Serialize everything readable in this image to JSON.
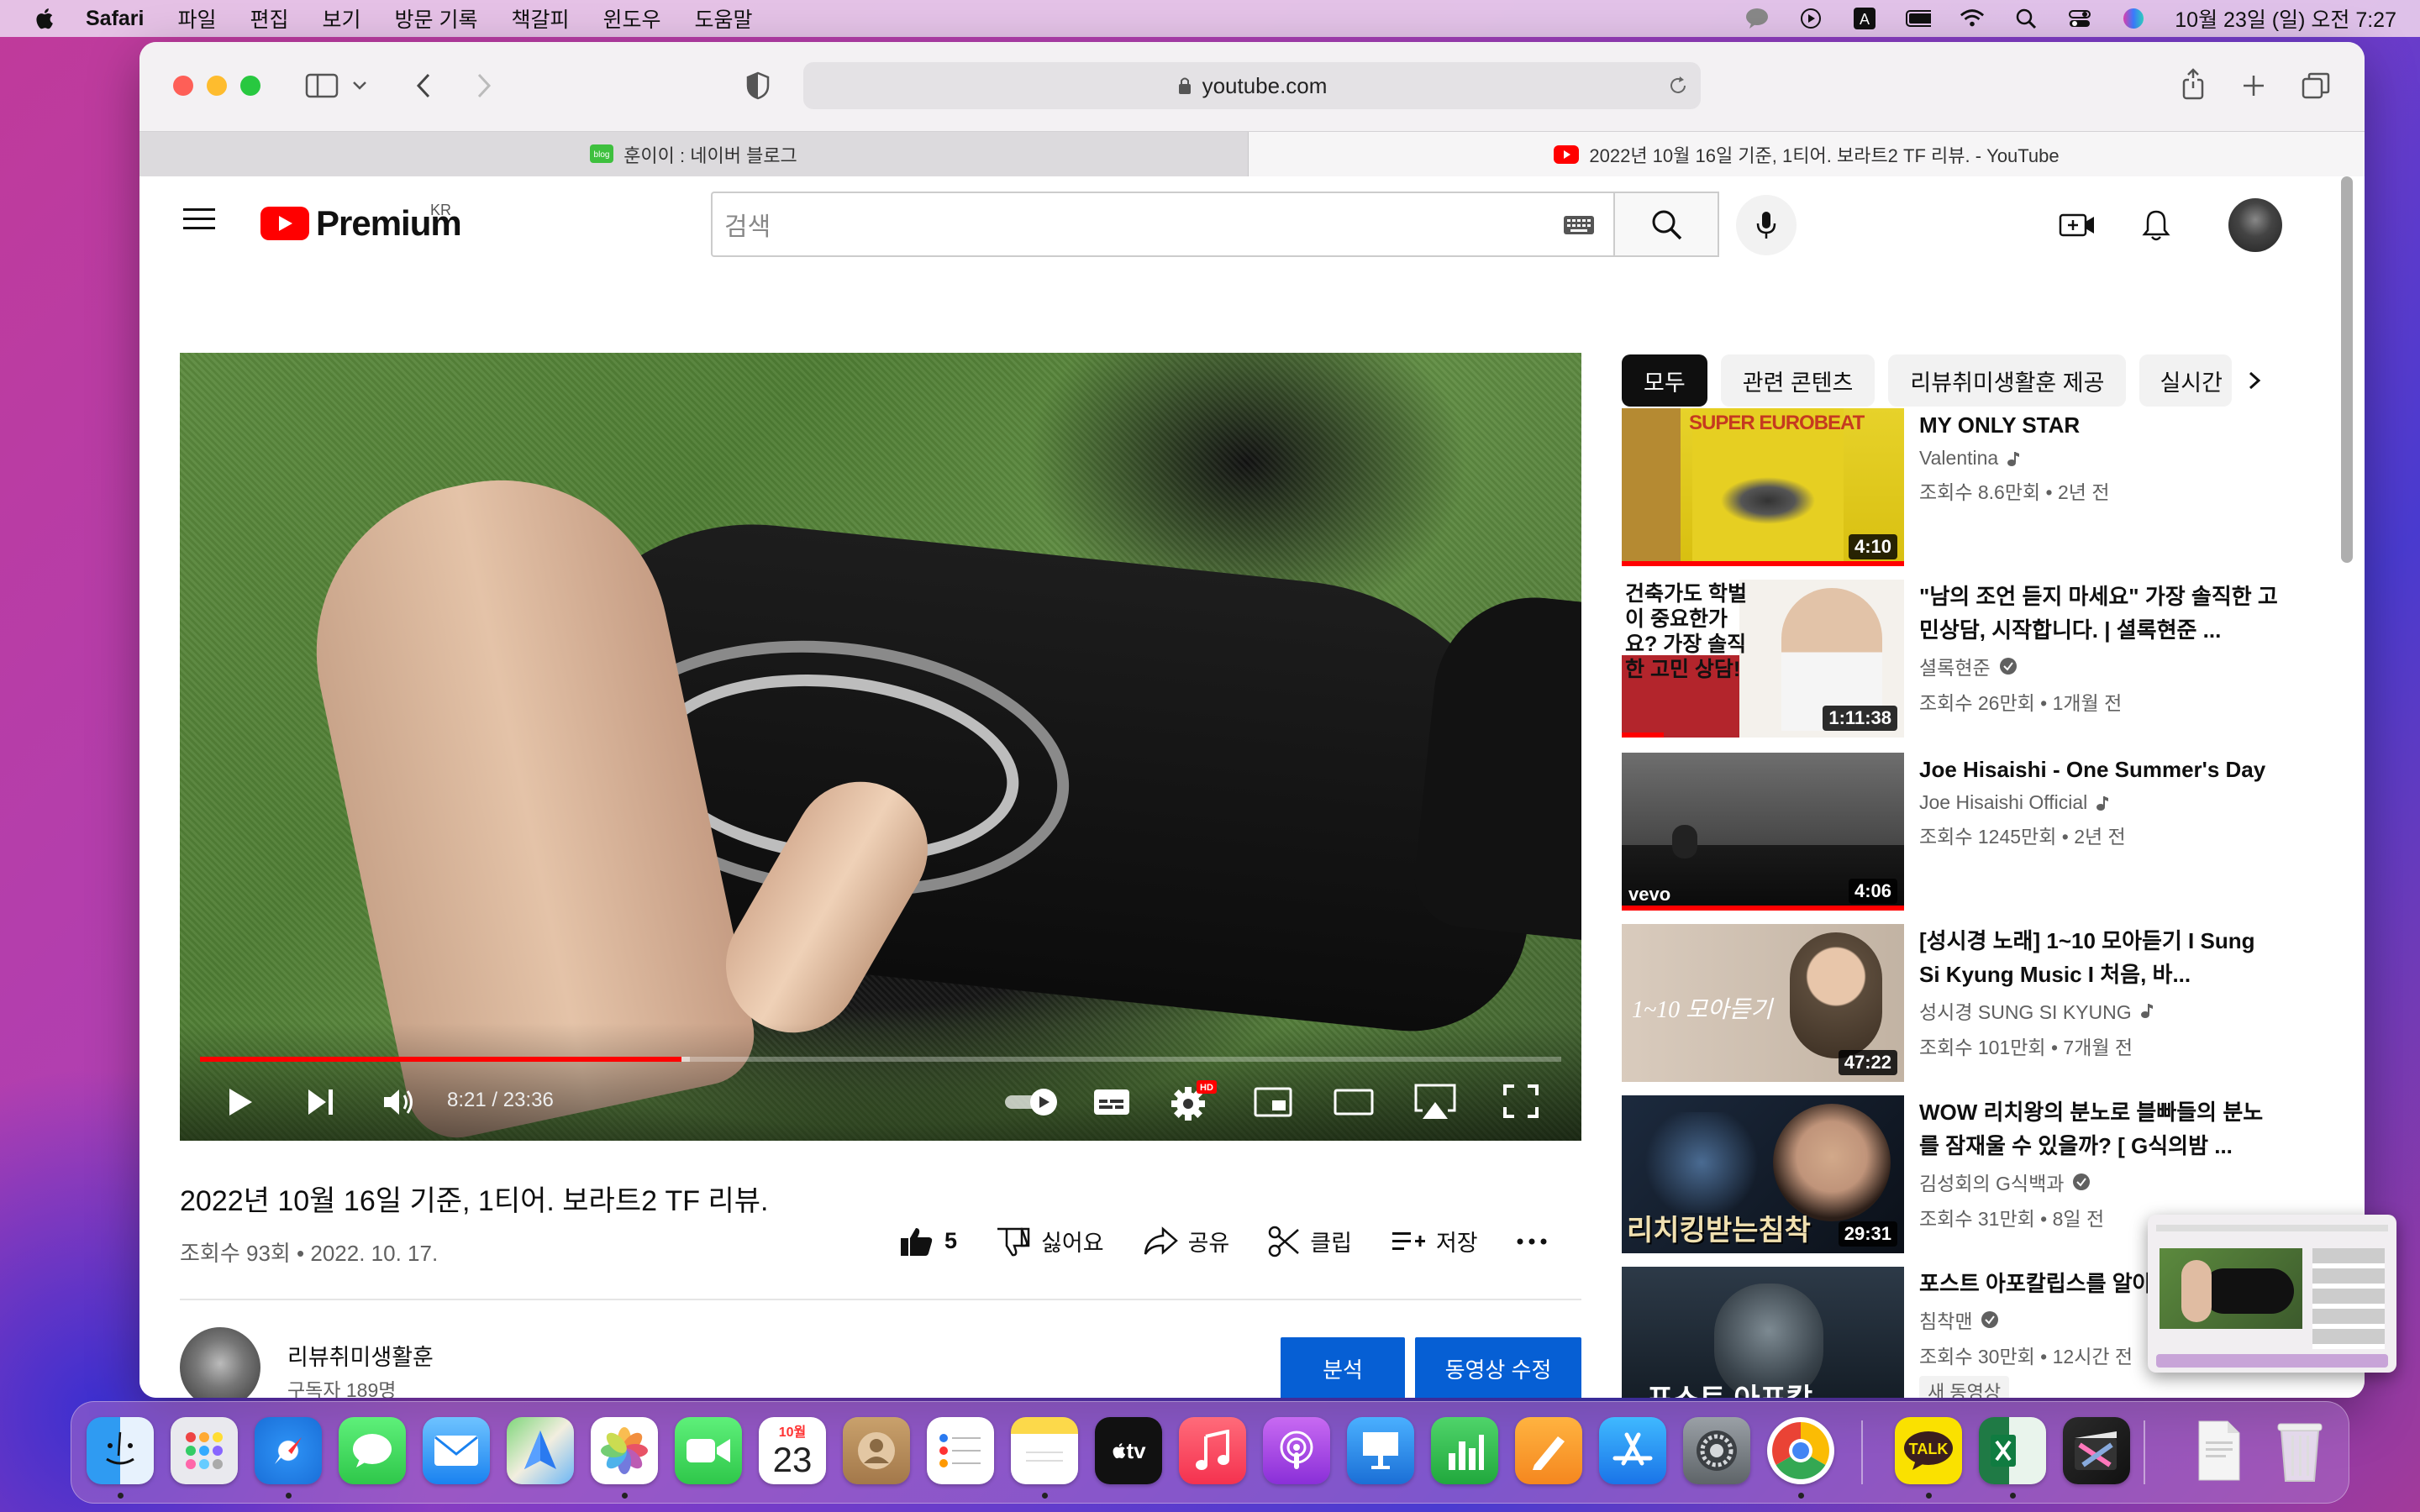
{
  "menubar": {
    "app": "Safari",
    "items": [
      "파일",
      "편집",
      "보기",
      "방문 기록",
      "책갈피",
      "윈도우",
      "도움말"
    ],
    "clock": "10월 23일 (일) 오전 7:27"
  },
  "browser": {
    "url": "youtube.com",
    "tabs": [
      {
        "label": "훈이이 : 네이버 블로그",
        "active": false
      },
      {
        "label": "2022년 10월 16일 기준, 1티어. 보라트2 TF 리뷰. - YouTube",
        "active": true
      }
    ]
  },
  "youtube": {
    "logo_text": "Premium",
    "logo_region": "KR",
    "search_placeholder": "검색",
    "player": {
      "time_current": "8:21",
      "time_separator": "/",
      "time_total": "23:36",
      "progress_fraction": 0.354,
      "buffered_fraction": 0.36
    },
    "video": {
      "title": "2022년 10월 16일 기준, 1티어. 보라트2 TF 리뷰.",
      "meta": "조회수 93회 • 2022. 10. 17.",
      "likes": "5",
      "dislike_label": "싫어요",
      "share_label": "공유",
      "clip_label": "클립",
      "save_label": "저장",
      "more_label": "..."
    },
    "channel": {
      "name": "리뷰취미생활훈",
      "subscribers": "구독자 189명",
      "analytics_button": "분석",
      "edit_button": "동영상 수정"
    },
    "chips": [
      "모두",
      "관련 콘텐츠",
      "리뷰취미생활훈 제공",
      "실시간"
    ],
    "recommendations": [
      {
        "title": "MY ONLY STAR",
        "channel": "Valentina",
        "verified": false,
        "music": true,
        "meta": "조회수 8.6만회 • 2년 전",
        "duration": "4:10",
        "watched": 1.0,
        "thumb_text": "SUPER EUROBEAT"
      },
      {
        "title": "\"남의 조언 듣지 마세요\" 가장 솔직한 고민상담, 시작합니다. | 셜록현준 ...",
        "channel": "셜록현준",
        "verified": true,
        "music": false,
        "meta": "조회수 26만회 • 1개월 전",
        "duration": "1:11:38",
        "watched": 0.15,
        "thumb_text": "건축가도 학벌이 중요한가요? 가장 솔직한 고민 상담!"
      },
      {
        "title": "Joe Hisaishi - One Summer's Day",
        "channel": "Joe Hisaishi Official",
        "verified": false,
        "music": true,
        "meta": "조회수 1245만회 • 2년 전",
        "duration": "4:06",
        "watched": 1.0,
        "thumb_text": "vevo"
      },
      {
        "title": "[성시경 노래] 1~10 모아듣기 I Sung Si Kyung Music I 처음, 바...",
        "channel": "성시경 SUNG SI KYUNG",
        "verified": false,
        "music": true,
        "meta": "조회수 101만회 • 7개월 전",
        "duration": "47:22",
        "watched": 0,
        "thumb_text": "1~10 모아듣기"
      },
      {
        "title": "WOW 리치왕의 분노로 블빠들의 분노를 잠재울 수 있을까? [ G식의밤 ...",
        "channel": "김성회의 G식백과",
        "verified": true,
        "music": false,
        "meta": "조회수 31만회 • 8일 전",
        "duration": "29:31",
        "watched": 0,
        "thumb_text": "리치킹받는침착"
      },
      {
        "title": "포스트 아포칼립스를 알아",
        "channel": "침착맨",
        "verified": true,
        "music": false,
        "meta": "조회수 30만회 • 12시간 전",
        "duration": "",
        "watched": 0,
        "badge": "새 동영상",
        "thumb_text": "포스트 아포칼"
      }
    ]
  },
  "dock": {
    "calendar_month": "10월",
    "calendar_day": "23",
    "kakao_label": "TALK",
    "tv_label": "tv"
  },
  "colors": {
    "yt_red": "#ff0000",
    "yt_blue": "#065fd4",
    "traffic_red": "#fe5f57",
    "traffic_yellow": "#febc2e",
    "traffic_green": "#28c840"
  }
}
